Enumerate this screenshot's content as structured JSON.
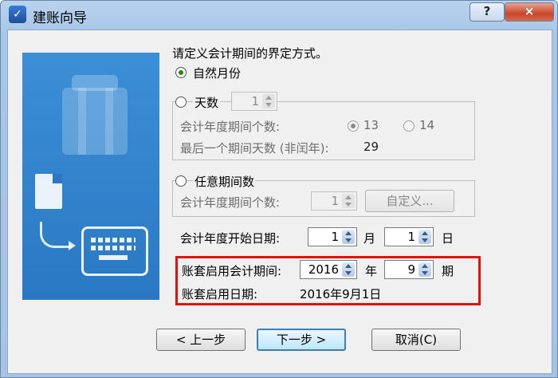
{
  "window": {
    "title": "建账向导",
    "help_label": "?",
    "close_label": "×"
  },
  "prompt": "请定义会计期间的界定方式。",
  "natural_month": {
    "label": "自然月份",
    "checked": true
  },
  "days": {
    "label": "天数",
    "value": "1",
    "periods_label": "会计年度期间个数:",
    "options": [
      "13",
      "14"
    ],
    "selected_option": "13",
    "last_period_label": "最后一个期间天数 (非闰年):",
    "last_period_value": "29"
  },
  "arbitrary": {
    "label": "任意期间数",
    "periods_label": "会计年度期间个数:",
    "value": "1",
    "custom_button": "自定义..."
  },
  "start_date": {
    "label": "会计年度开始日期:",
    "month_value": "1",
    "month_unit": "月",
    "day_value": "1",
    "day_unit": "日"
  },
  "enable_period": {
    "label": "账套启用会计期间:",
    "year_value": "2016",
    "year_unit": "年",
    "period_value": "9",
    "period_unit": "期"
  },
  "enable_date": {
    "label": "账套启用日期:",
    "value": "2016年9月1日"
  },
  "buttons": {
    "prev": "< 上一步",
    "next": "下一步 >",
    "cancel": "取消(C)"
  },
  "colors": {
    "highlight_box": "#e31010",
    "side_art": "#2a78c4"
  },
  "icons": [
    "app-icon",
    "luggage-icon",
    "document-icon",
    "arrow-icon",
    "keyboard-icon"
  ]
}
